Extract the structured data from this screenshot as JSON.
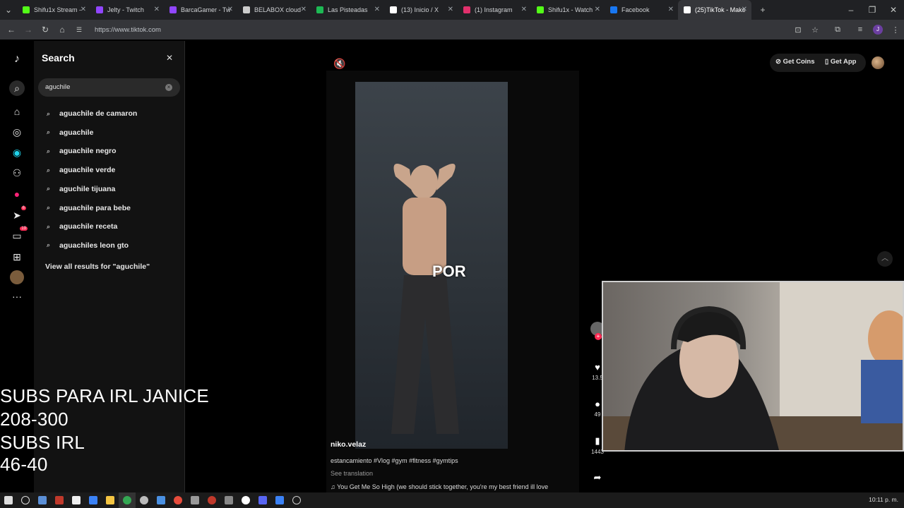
{
  "browser": {
    "tabs": [
      {
        "label": "Shifu1x Stream - ",
        "color": "#53fc18"
      },
      {
        "label": "Jelty - Twitch",
        "color": "#9146ff"
      },
      {
        "label": "BarcaGamer - Tw",
        "color": "#9146ff"
      },
      {
        "label": "BELABOX cloud",
        "color": "#cccccc"
      },
      {
        "label": "Las Pisteadas",
        "color": "#1db954"
      },
      {
        "label": "(13) Inicio / X",
        "color": "#ffffff"
      },
      {
        "label": "(1) Instagram",
        "color": "#e1306c"
      },
      {
        "label": "Shifu1x - Watch ",
        "color": "#53fc18"
      },
      {
        "label": "Facebook",
        "color": "#1877f2"
      },
      {
        "label": "(25)TikTok - Make",
        "color": "#ffffff"
      }
    ],
    "url": "https://www.tiktok.com"
  },
  "search": {
    "title": "Search",
    "query": "aguchile",
    "suggestions": [
      "aguachile de camaron",
      "aguachile",
      "aguachile negro",
      "aguachile verde",
      "aguchile tijuana",
      "aguachile para bebe",
      "aguachile receta",
      "aguachiles leon gto"
    ],
    "view_all": "View all results for \"aguchile\""
  },
  "overlay": {
    "line1": "SUBS PARA IRL JANICE",
    "line2": "208-300",
    "line3": "SUBS IRL",
    "line4": "46-40"
  },
  "video": {
    "caption_word": "POR",
    "author": "niko.velaz",
    "tags": "estancamiento #Vlog #gym #fitness #gymtips",
    "see_translation": "See translation",
    "music": "You Get Me So High (we should stick together, you're my best friend ill love",
    "likes": "13.5",
    "comments": "49",
    "saves": "1443"
  },
  "header": {
    "get_coins": "Get Coins",
    "get_app": "Get App"
  },
  "rail_badges": {
    "messages": "6",
    "inbox": "19"
  },
  "taskbar": {
    "clock": "10:11 p. m."
  }
}
